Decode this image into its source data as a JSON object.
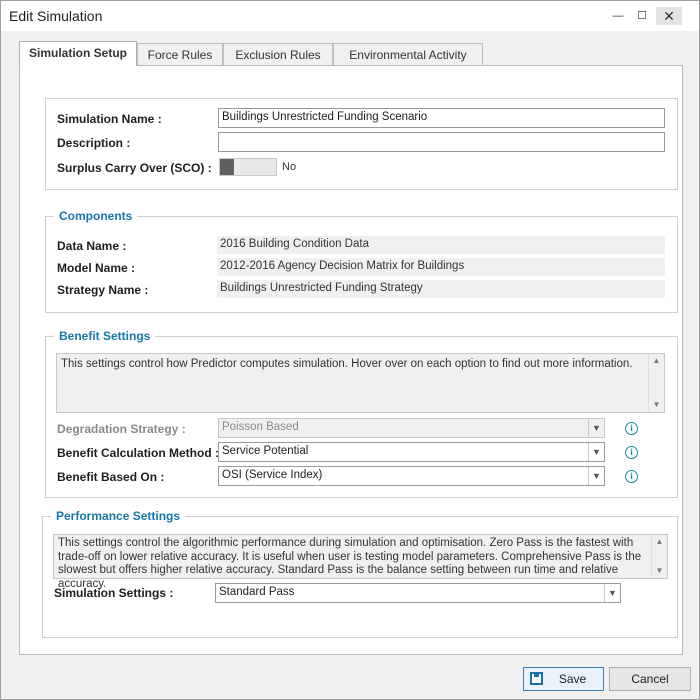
{
  "window": {
    "title": "Edit Simulation",
    "minimize_glyph": "—",
    "maximize_glyph": "☐",
    "close_glyph": "✕"
  },
  "tabs": [
    {
      "label": "Simulation Setup",
      "active": true
    },
    {
      "label": "Force Rules",
      "active": false
    },
    {
      "label": "Exclusion Rules",
      "active": false
    },
    {
      "label": "Environmental Activity",
      "active": false
    }
  ],
  "general": {
    "simulation_name_label": "Simulation Name :",
    "simulation_name_value": "Buildings Unrestricted Funding Scenario",
    "description_label": "Description :",
    "description_value": "",
    "sco_label": "Surplus Carry Over (SCO) :",
    "sco_value": "No",
    "sco_on": false
  },
  "components": {
    "title": "Components",
    "data_name_label": "Data Name :",
    "data_name_value": "2016 Building Condition Data",
    "model_name_label": "Model Name :",
    "model_name_value": "2012-2016 Agency Decision Matrix for Buildings",
    "strategy_name_label": "Strategy Name :",
    "strategy_name_value": "Buildings Unrestricted Funding Strategy"
  },
  "benefit": {
    "title": "Benefit Settings",
    "description": "This settings control how Predictor computes simulation. Hover over on each option to find out more information.",
    "degradation_label": "Degradation Strategy :",
    "degradation_value": "Poisson Based",
    "calc_method_label": "Benefit Calculation Method :",
    "calc_method_value": "Service Potential",
    "based_on_label": "Benefit Based On :",
    "based_on_value": "OSI (Service Index)"
  },
  "performance": {
    "title": "Performance Settings",
    "description": "This settings control the algorithmic performance during simulation and optimisation. Zero Pass is the fastest with trade-off on lower relative accuracy. It is useful when user is testing model parameters. Comprehensive Pass is the slowest but offers higher relative accuracy. Standard Pass is the balance setting between run time and relative accuracy.",
    "simulation_settings_label": "Simulation Settings :",
    "simulation_settings_value": "Standard Pass"
  },
  "footer": {
    "save_label": "Save",
    "cancel_label": "Cancel"
  },
  "icons": {
    "info_glyph": "i",
    "dropdown_glyph": "▼",
    "scroll_up_glyph": "▲",
    "scroll_down_glyph": "▼"
  },
  "colors": {
    "group_title": "#1777a6",
    "info_icon": "#1a8c98",
    "save_icon": "#1e6fa8"
  }
}
